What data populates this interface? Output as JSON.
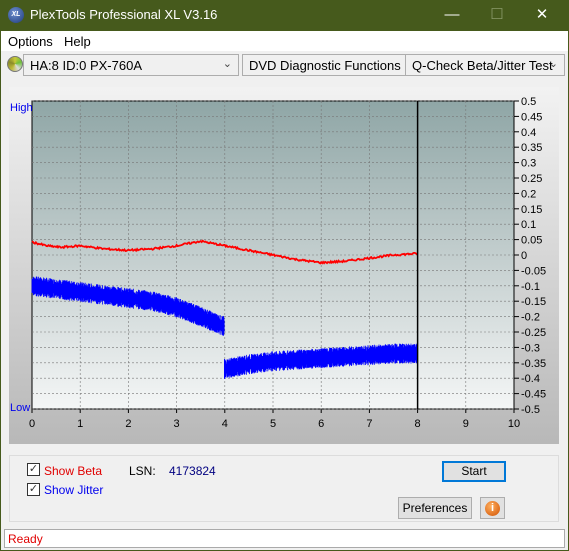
{
  "window": {
    "title": "PlexTools Professional XL V3.16",
    "logo_text": "XL"
  },
  "menu": [
    "Options",
    "Help"
  ],
  "toolbar": {
    "drive": "HA:8 ID:0  PX-760A",
    "function": "DVD Diagnostic Functions",
    "test": "Q-Check Beta/Jitter Test"
  },
  "controls": {
    "show_beta": "Show Beta",
    "show_jitter": "Show Jitter",
    "beta_checked": true,
    "jitter_checked": true,
    "lsn_label": "LSN:",
    "lsn_value": "4173824",
    "start": "Start",
    "preferences": "Preferences",
    "info_icon": "info-icon"
  },
  "status": "Ready",
  "colors": {
    "beta": "#ff0000",
    "jitter": "#0000ff",
    "title_bar": "#465a1c"
  },
  "chart_data": {
    "type": "line",
    "left_axis_labels": {
      "top": "High",
      "bottom": "Low"
    },
    "xlim": [
      0,
      10
    ],
    "ylim": [
      -0.5,
      0.5
    ],
    "x_ticks": [
      0,
      1,
      2,
      3,
      4,
      5,
      6,
      7,
      8,
      9,
      10
    ],
    "y_ticks": [
      "0.5",
      "0.45",
      "0.4",
      "0.35",
      "0.3",
      "0.25",
      "0.2",
      "0.15",
      "0.1",
      "0.05",
      "0",
      "-0.05",
      "-0.1",
      "-0.15",
      "-0.2",
      "-0.25",
      "-0.3",
      "-0.35",
      "-0.4",
      "-0.45",
      "-0.5"
    ],
    "grid": true,
    "marker_x": 8,
    "series": [
      {
        "name": "Beta",
        "color": "#ff0000",
        "x": [
          0,
          0.3,
          0.6,
          1,
          1.5,
          2,
          2.5,
          3,
          3.5,
          4,
          4.5,
          5,
          5.5,
          6,
          6.5,
          7,
          7.5,
          8
        ],
        "y": [
          0.042,
          0.03,
          0.025,
          0.03,
          0.02,
          0.015,
          0.02,
          0.03,
          0.045,
          0.03,
          0.015,
          0.0,
          -0.015,
          -0.025,
          -0.02,
          -0.01,
          0.0,
          0.005
        ]
      },
      {
        "name": "Jitter",
        "color": "#0000ff",
        "x": [
          0,
          0.5,
          1,
          1.5,
          2,
          2.5,
          3,
          3.5,
          3.95,
          4.0,
          4.5,
          5,
          5.5,
          6,
          6.5,
          7,
          7.5,
          8
        ],
        "y": [
          -0.1,
          -0.11,
          -0.12,
          -0.13,
          -0.14,
          -0.15,
          -0.17,
          -0.2,
          -0.23,
          -0.37,
          -0.355,
          -0.345,
          -0.34,
          -0.335,
          -0.33,
          -0.325,
          -0.32,
          -0.32
        ],
        "spread": 0.05
      }
    ]
  }
}
